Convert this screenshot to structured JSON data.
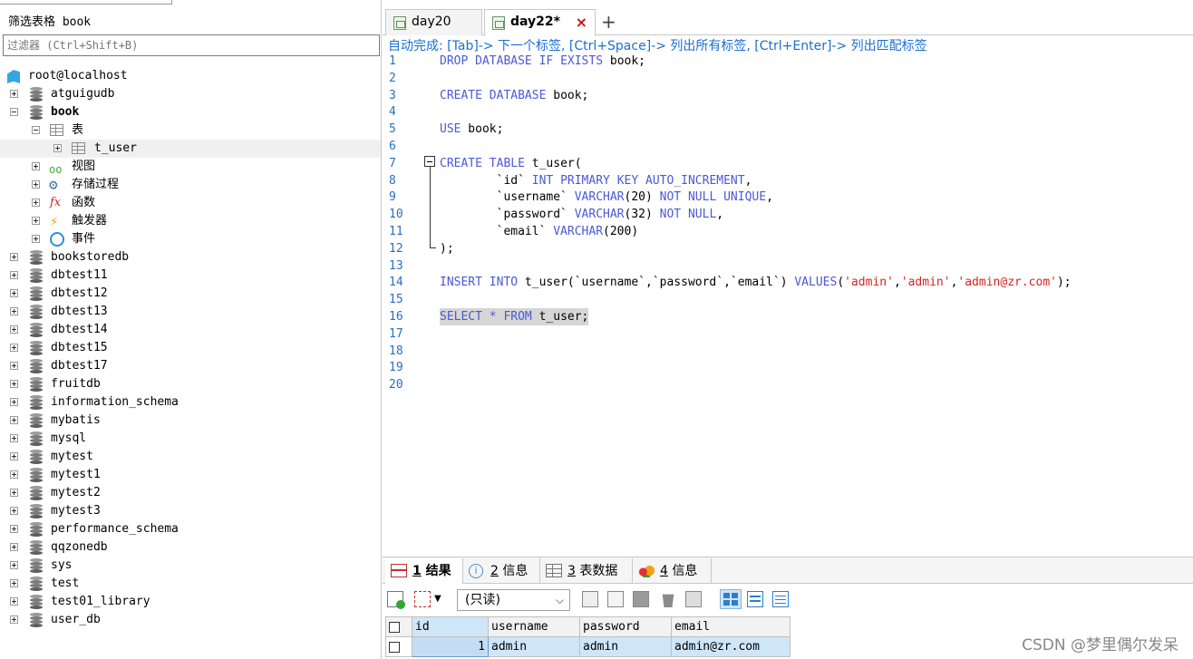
{
  "left_panel": {
    "filter_title": "筛选表格 book",
    "filter_placeholder": "过滤器 (Ctrl+Shift+B)",
    "connection": "root@localhost",
    "databases": [
      "atguigudb",
      "book",
      "bookstoredb",
      "dbtest11",
      "dbtest12",
      "dbtest13",
      "dbtest14",
      "dbtest15",
      "dbtest17",
      "fruitdb",
      "information_schema",
      "mybatis",
      "mysql",
      "mytest",
      "mytest1",
      "mytest2",
      "mytest3",
      "performance_schema",
      "qqzonedb",
      "sys",
      "test",
      "test01_library",
      "user_db"
    ],
    "book_children": {
      "tables": "表",
      "table_item": "t_user",
      "views": "视图",
      "procedures": "存储过程",
      "functions": "函数",
      "triggers": "触发器",
      "events": "事件"
    }
  },
  "tabs": [
    {
      "label": "day20"
    },
    {
      "label": "day22*",
      "close": "×"
    }
  ],
  "add_tab": "+",
  "hint": "自动完成: [Tab]-> 下一个标签, [Ctrl+Space]-> 列出所有标签, [Ctrl+Enter]-> 列出匹配标签",
  "editor": {
    "lines": [
      {
        "n": "1",
        "t": "DROP DATABASE IF EXISTS book;"
      },
      {
        "n": "2",
        "t": ""
      },
      {
        "n": "3",
        "t": "CREATE DATABASE book;"
      },
      {
        "n": "4",
        "t": ""
      },
      {
        "n": "5",
        "t": "USE book;"
      },
      {
        "n": "6",
        "t": ""
      },
      {
        "n": "7",
        "t": "CREATE TABLE t_user("
      },
      {
        "n": "8",
        "t": "        `id` INT PRIMARY KEY AUTO_INCREMENT,"
      },
      {
        "n": "9",
        "t": "        `username` VARCHAR(20) NOT NULL UNIQUE,"
      },
      {
        "n": "10",
        "t": "        `password` VARCHAR(32) NOT NULL,"
      },
      {
        "n": "11",
        "t": "        `email` VARCHAR(200)"
      },
      {
        "n": "12",
        "t": ");"
      },
      {
        "n": "13",
        "t": ""
      },
      {
        "n": "14",
        "t": "INSERT INTO t_user(`username`,`password`,`email`) VALUES('admin','admin','admin@zr.com');"
      },
      {
        "n": "15",
        "t": ""
      },
      {
        "n": "16",
        "t": "SELECT * FROM t_user;"
      },
      {
        "n": "17",
        "t": ""
      },
      {
        "n": "18",
        "t": ""
      },
      {
        "n": "19",
        "t": ""
      },
      {
        "n": "20",
        "t": ""
      }
    ]
  },
  "result_tabs": [
    {
      "num": "1",
      "label": "结果"
    },
    {
      "num": "2",
      "label": "信息"
    },
    {
      "num": "3",
      "label": "表数据"
    },
    {
      "num": "4",
      "label": "信息"
    }
  ],
  "toolbar": {
    "readonly_option": "(只读)"
  },
  "grid": {
    "columns": [
      "id",
      "username",
      "password",
      "email"
    ],
    "rows": [
      [
        "1",
        "admin",
        "admin",
        "admin@zr.com"
      ]
    ]
  },
  "watermark": "CSDN @梦里偶尔发呆",
  "colors": {
    "keyword": "#4b59d6",
    "string": "#d8241c",
    "hint": "#1a6fd1",
    "grid_selection": "#cfe6f8"
  }
}
